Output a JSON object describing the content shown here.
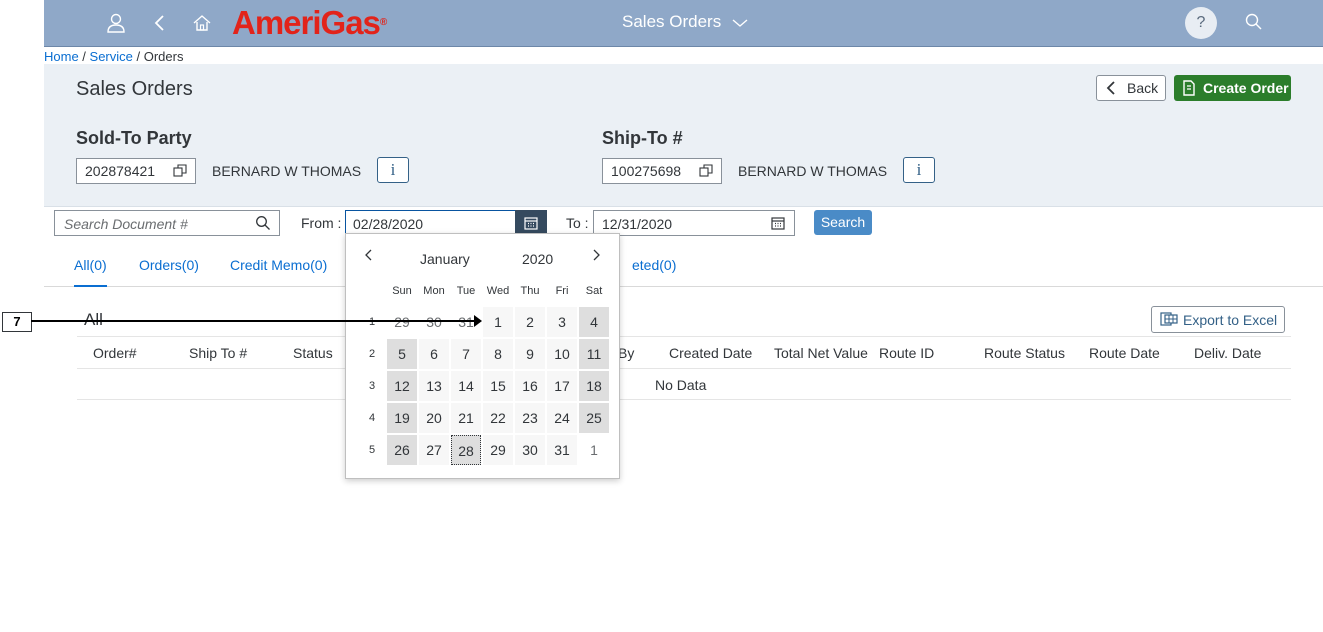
{
  "shell": {
    "logo_text": "AmeriGas",
    "logo_reg": "®",
    "title": "Sales Orders",
    "help_label": "?"
  },
  "breadcrumb": {
    "home": "Home",
    "sep": " / ",
    "service": "Service",
    "orders": "Orders"
  },
  "header": {
    "page_title": "Sales Orders",
    "back_label": "Back",
    "create_label": "Create Order",
    "sold_to": {
      "label": "Sold-To Party",
      "id": "202878421",
      "name": "BERNARD W THOMAS",
      "info": "i"
    },
    "ship_to": {
      "label": "Ship-To #",
      "id": "100275698",
      "name": "BERNARD W THOMAS",
      "info": "i"
    }
  },
  "filters": {
    "search_placeholder": "Search Document #",
    "from_label": "From :",
    "from_value": "02/28/2020",
    "to_label": "To :",
    "to_value": "12/31/2020",
    "search_label": "Search"
  },
  "tabs": [
    {
      "label": "All(0)"
    },
    {
      "label": "Orders(0)"
    },
    {
      "label": "Credit Memo(0)"
    },
    {
      "label": "eted(0)"
    }
  ],
  "table": {
    "title": "All",
    "export_label": "Export to Excel",
    "columns": [
      "Order#",
      "Ship To #",
      "Status",
      "By",
      "Created Date",
      "Total Net Value",
      "Route ID",
      "Route Status",
      "Route Date",
      "Deliv. Date"
    ],
    "no_data": "No Data"
  },
  "calendar": {
    "month": "January",
    "year": "2020",
    "weekdays": [
      "Sun",
      "Mon",
      "Tue",
      "Wed",
      "Thu",
      "Fri",
      "Sat"
    ],
    "weeks": [
      {
        "num": "1",
        "days": [
          "29",
          "30",
          "31",
          "1",
          "2",
          "3",
          "4"
        ]
      },
      {
        "num": "2",
        "days": [
          "5",
          "6",
          "7",
          "8",
          "9",
          "10",
          "11"
        ]
      },
      {
        "num": "3",
        "days": [
          "12",
          "13",
          "14",
          "15",
          "16",
          "17",
          "18"
        ]
      },
      {
        "num": "4",
        "days": [
          "19",
          "20",
          "21",
          "22",
          "23",
          "24",
          "25"
        ]
      },
      {
        "num": "5",
        "days": [
          "26",
          "27",
          "28",
          "29",
          "30",
          "31",
          "1"
        ]
      }
    ]
  },
  "annotation": {
    "label": "7"
  },
  "colors": {
    "shellbar": "#8fa8c8",
    "logo_red": "#e2231a",
    "link_blue": "#0a6ed1",
    "create_green": "#2b7d2b",
    "search_blue": "#4a8bc7"
  }
}
